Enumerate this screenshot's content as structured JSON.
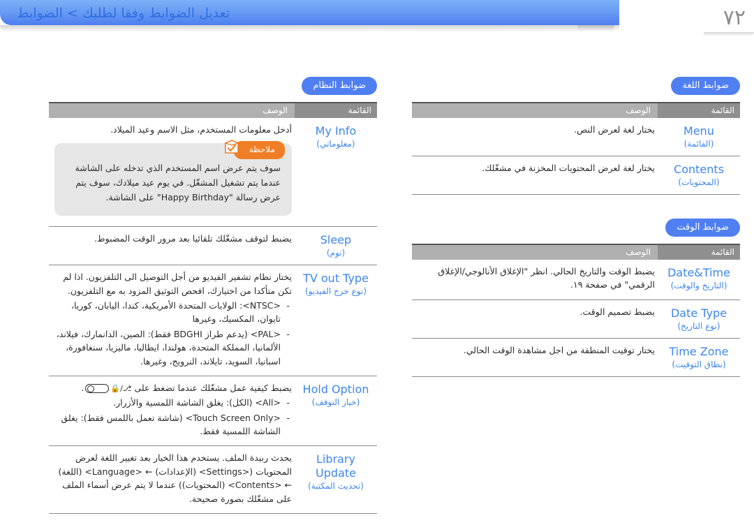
{
  "page": {
    "number": "٧٢",
    "header_title": "تعديل الضوابط وفقا لطلبك > الضوابط"
  },
  "left_column": {
    "badge": "ضوابط النظام",
    "table": {
      "headers": {
        "menu": "القائمة",
        "description": "الوصف"
      },
      "rows": [
        {
          "menu_en": "My Info",
          "menu_ar": "(معلوماتي)",
          "desc_main": "أدخل معلومات المستخدم، مثل الاسم وعيد الميلاد.",
          "note": {
            "tag": "ملاحظة",
            "icon": "note-check-box-icon",
            "text": "سوف يتم عرض اسم المستخدم الذي تدخله على الشاشة عندما يتم تشغيل المشغّل. في يوم عيد ميلادك، سوف يتم عرض رسالة \"Happy Birthday\" على الشاشة."
          }
        },
        {
          "menu_en": "Sleep",
          "menu_ar": "(نوم)",
          "desc_main": "يضبط لتوقف مشغّلك تلقائيا بعد مرور الوقت المضبوط."
        },
        {
          "menu_en": "TV out Type",
          "menu_ar": "(نوع خرج الفيديو)",
          "desc_main": "يختار نظام تشفير الفيديو من أجل التوصيل الى التلفزيون. اذا لم تكن متأكدا من اختيارك، افحص التوثيق المزود به مع التلفزيون.",
          "bullets": [
            "<NTSC>: الولايات المتحدة الأمريكية، كندا، اليابان، كوريا، تايوان، المكسيك، وغيرها",
            "<PAL> (يدعم طراز BDGHI فقط): الصين، الدانمارك، فيلاند، الألمانيا، المملكة المتحدة، هولندا، ايطاليا، ماليزيا، سنغافورة، اسبانيا، السويد، تايلاند، النرويج، وغيرها."
          ]
        },
        {
          "menu_en": "Hold Option",
          "menu_ar": "(خيار التوقف)",
          "desc_main_before": "يضبط كيفية عمل مشغّلك عندما تضغط على",
          "desc_icon": "hold-switch-icon",
          "desc_main_after": ".",
          "bullets": [
            "<All> (الكل): يغلق الشاشة اللمسية والأزرار.",
            "<Touch Screen Only> (شاشة تعمل باللمس فقط): يغلق الشاشة اللمسية فقط."
          ]
        },
        {
          "menu_en": "Library Update",
          "menu_ar": "(تحديث المكتبة)",
          "desc_main": "يحدث ربيدة الملف. يستخدم هذا الخيار بعد تغيير اللغة لعرض المحتويات (<Settings> (الإعدادات) ← <Language> (اللغة) ← <Contents> (المحتويات)) عندما لا يتم عرض أسماء الملف على مشغّلك بصورة صحيحة."
        }
      ]
    }
  },
  "right_column": {
    "sections": [
      {
        "badge": "ضوابط اللغة",
        "table": {
          "headers": {
            "menu": "القائمة",
            "description": "الوصف"
          },
          "rows": [
            {
              "menu_en": "Menu",
              "menu_ar": "(القائمة)",
              "desc_main": "يختار لغة لعرض النص."
            },
            {
              "menu_en": "Contents",
              "menu_ar": "(المحتويات)",
              "desc_main": "يختار لغة لعرض المحتويات المخزنة في مشغّلك."
            }
          ]
        }
      },
      {
        "badge": "ضوابط الوقت",
        "table": {
          "headers": {
            "menu": "القائمة",
            "description": "الوصف"
          },
          "rows": [
            {
              "menu_en": "Date&Time",
              "menu_ar": "(التاريخ والوقت)",
              "desc_main": "يضبط الوقت والتاريخ الحالي. انظر \"الإغلاق الأنالوجي/الإغلاق الرقمي\" في صفحة ١٩."
            },
            {
              "menu_en": "Date Type",
              "menu_ar": "(نوع التاريخ)",
              "desc_main": "يضبط تصميم الوقت."
            },
            {
              "menu_en": "Time Zone",
              "menu_ar": "(نطاق التوقيت)",
              "desc_main": "يختار توقيت المنطقة من اجل مشاهدة الوقت الحالي."
            }
          ]
        }
      }
    ]
  },
  "colors": {
    "header_blue": "#4d7ef0",
    "menu_blue": "#3d86f0",
    "badge_blue": "#4f7ff0",
    "note_orange": "#f07e26",
    "table_header_gray": "#a6a6a6"
  }
}
